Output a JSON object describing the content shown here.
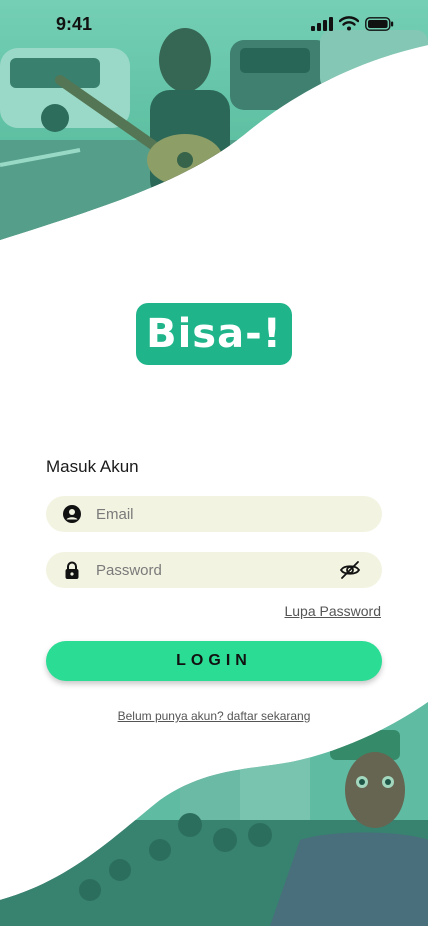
{
  "status_bar": {
    "time": "9:41"
  },
  "logo": {
    "text": "Bisa-!"
  },
  "form": {
    "title": "Masuk Akun",
    "email_placeholder": "Email",
    "password_placeholder": "Password",
    "forgot_label": "Lupa Password",
    "login_label": "LOGIN",
    "register_label": "Belum punya akun? daftar sekarang"
  },
  "colors": {
    "brand": "#1fb48a",
    "button": "#2bdc94",
    "field_bg": "#f3f3e2",
    "photo_tint": "#2fbf98"
  },
  "icons": {
    "email": "user-circle-icon",
    "password": "lock-icon",
    "toggle": "eye-off-icon"
  }
}
